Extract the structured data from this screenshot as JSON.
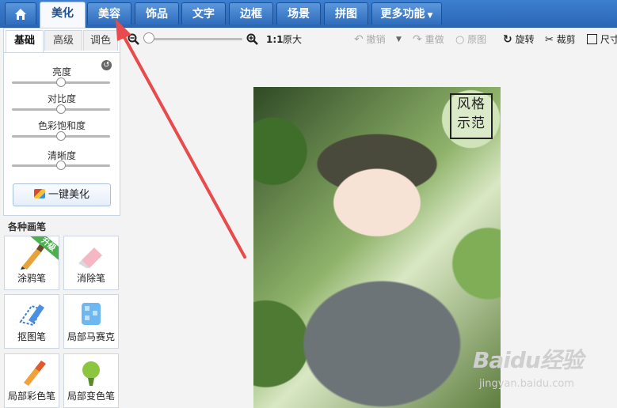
{
  "nav": {
    "home_icon": "home-icon",
    "tabs": [
      {
        "label": "美化"
      },
      {
        "label": "美容"
      },
      {
        "label": "饰品"
      },
      {
        "label": "文字"
      },
      {
        "label": "边框"
      },
      {
        "label": "场景"
      },
      {
        "label": "拼图"
      },
      {
        "label": "更多功能"
      }
    ],
    "active_tab": "美化"
  },
  "toolbar": {
    "zoom_out_icon": "zoom-out-icon",
    "zoom_in_icon": "zoom-in-icon",
    "ratio": "1:1",
    "original_size": "原大",
    "undo": "撤销",
    "redo": "重做",
    "original_image": "原图",
    "rotate": "旋转",
    "crop": "裁剪",
    "resize": "尺寸"
  },
  "panel": {
    "tabs": [
      "基础",
      "高级",
      "调色"
    ],
    "adjustments": [
      {
        "label": "亮度",
        "value": 0.5
      },
      {
        "label": "对比度",
        "value": 0.5
      },
      {
        "label": "色彩饱和度",
        "value": 0.5
      },
      {
        "label": "清晰度",
        "value": 0.5
      }
    ],
    "auto_beautify": "一键美化"
  },
  "brushes": {
    "title": "各种画笔",
    "items": [
      {
        "label": "涂鸦笔",
        "badge": "升级",
        "icon": "brush-pencil-icon"
      },
      {
        "label": "消除笔",
        "icon": "eraser-icon"
      },
      {
        "label": "抠图笔",
        "icon": "cutout-pen-icon"
      },
      {
        "label": "局部马赛克",
        "icon": "mosaic-icon"
      },
      {
        "label": "局部彩色笔",
        "icon": "color-brush-icon"
      },
      {
        "label": "局部变色笔",
        "icon": "recolor-pen-icon"
      }
    ]
  },
  "photo": {
    "stamp_lines": [
      "风格",
      "示范"
    ]
  },
  "watermark": {
    "line1": "Baidu经验",
    "line2": "jingyan.baidu.com"
  },
  "colors": {
    "nav_bg": "#2a66b6",
    "arrow": "#e84b4b",
    "badge_green": "#4caf50"
  }
}
